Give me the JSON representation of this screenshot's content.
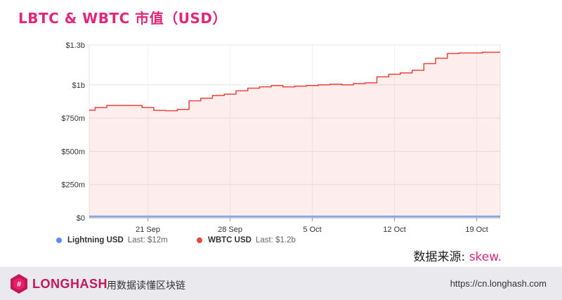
{
  "title": "LBTC & WBTC 市值（USD）",
  "source": {
    "label": "数据来源: ",
    "brand": "skew."
  },
  "footer": {
    "logo_text": "LONGHASH",
    "slogan": "用数据读懂区块链",
    "url": "https://cn.longhash.com"
  },
  "legend": [
    {
      "name": "Lightning USD",
      "last": "Last: $12m",
      "color": "#5b8def"
    },
    {
      "name": "WBTC USD",
      "last": "Last: $1.2b",
      "color": "#e8453c"
    }
  ],
  "chart_data": {
    "type": "area",
    "title": "LBTC & WBTC 市值（USD）",
    "ylim": [
      0,
      1300
    ],
    "y_unit": "USD millions",
    "y_ticks": [
      {
        "value": 0,
        "label": "$0"
      },
      {
        "value": 250,
        "label": "$250m"
      },
      {
        "value": 500,
        "label": "$500m"
      },
      {
        "value": 750,
        "label": "$750m"
      },
      {
        "value": 1000,
        "label": "$1b"
      },
      {
        "value": 1300,
        "label": "$1.3b"
      }
    ],
    "x_range": [
      "2020-09-16",
      "2020-10-21"
    ],
    "x_ticks": [
      {
        "date": "2020-09-21",
        "label": "21 Sep"
      },
      {
        "date": "2020-09-28",
        "label": "28 Sep"
      },
      {
        "date": "2020-10-05",
        "label": "5 Oct"
      },
      {
        "date": "2020-10-12",
        "label": "12 Oct"
      },
      {
        "date": "2020-10-19",
        "label": "19 Oct"
      }
    ],
    "grid": true,
    "series": [
      {
        "name": "WBTC USD",
        "color": "#e8453c",
        "points": [
          [
            "2020-09-16",
            810
          ],
          [
            "2020-09-17",
            830
          ],
          [
            "2020-09-18",
            845
          ],
          [
            "2020-09-19",
            845
          ],
          [
            "2020-09-20",
            845
          ],
          [
            "2020-09-21",
            830
          ],
          [
            "2020-09-22",
            808
          ],
          [
            "2020-09-23",
            805
          ],
          [
            "2020-09-24",
            815
          ],
          [
            "2020-09-25",
            880
          ],
          [
            "2020-09-26",
            900
          ],
          [
            "2020-09-27",
            920
          ],
          [
            "2020-09-28",
            930
          ],
          [
            "2020-09-29",
            955
          ],
          [
            "2020-09-30",
            975
          ],
          [
            "2020-10-01",
            985
          ],
          [
            "2020-10-02",
            995
          ],
          [
            "2020-10-03",
            985
          ],
          [
            "2020-10-04",
            990
          ],
          [
            "2020-10-05",
            995
          ],
          [
            "2020-10-06",
            1000
          ],
          [
            "2020-10-07",
            1005
          ],
          [
            "2020-10-08",
            1000
          ],
          [
            "2020-10-09",
            1010
          ],
          [
            "2020-10-10",
            1015
          ],
          [
            "2020-10-11",
            1060
          ],
          [
            "2020-10-12",
            1080
          ],
          [
            "2020-10-13",
            1090
          ],
          [
            "2020-10-14",
            1110
          ],
          [
            "2020-10-15",
            1160
          ],
          [
            "2020-10-16",
            1200
          ],
          [
            "2020-10-17",
            1235
          ],
          [
            "2020-10-18",
            1240
          ],
          [
            "2020-10-19",
            1240
          ],
          [
            "2020-10-20",
            1245
          ],
          [
            "2020-10-21",
            1245
          ]
        ]
      },
      {
        "name": "Lightning USD",
        "color": "#5b8def",
        "points": [
          [
            "2020-09-16",
            12
          ],
          [
            "2020-10-21",
            12
          ]
        ]
      }
    ]
  }
}
